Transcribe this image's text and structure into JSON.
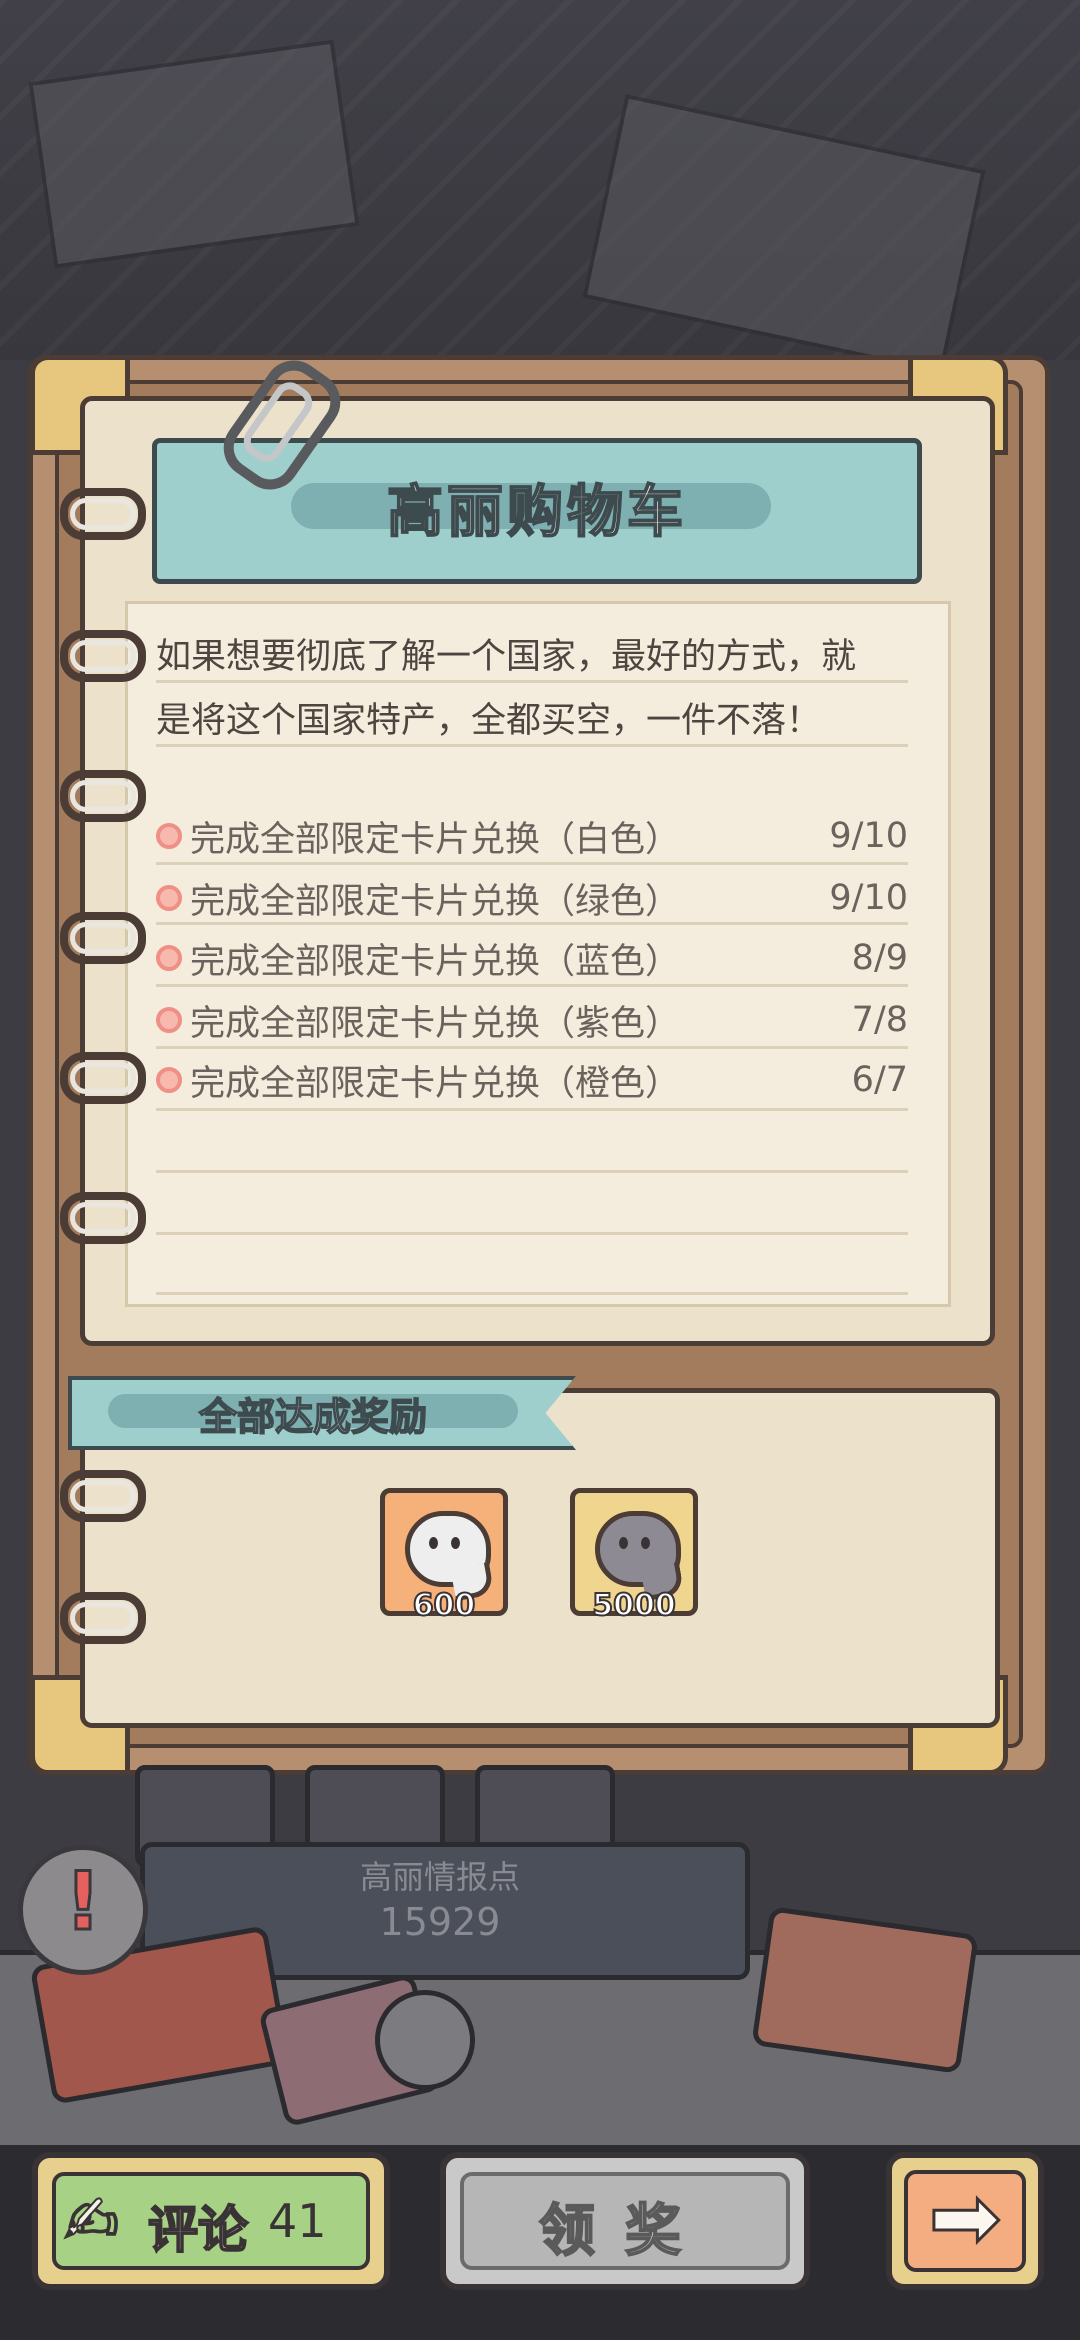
{
  "card": {
    "title": "高丽购物车",
    "description_lines": [
      "如果想要彻底了解一个国家，最好的方式，就",
      "是将这个国家特产，全都买空，一件不落！"
    ],
    "tasks": [
      {
        "label": "完成全部限定卡片兑换（白色）",
        "count": "9/10"
      },
      {
        "label": "完成全部限定卡片兑换（绿色）",
        "count": "9/10"
      },
      {
        "label": "完成全部限定卡片兑换（蓝色）",
        "count": "8/9"
      },
      {
        "label": "完成全部限定卡片兑换（紫色）",
        "count": "7/8"
      },
      {
        "label": "完成全部限定卡片兑换（橙色）",
        "count": "6/7"
      }
    ]
  },
  "rewards": {
    "header": "全部达成奖励",
    "items": [
      {
        "icon": "white-ghost-icon",
        "amount": "600"
      },
      {
        "icon": "gray-ghost-icon",
        "amount": "5000"
      }
    ]
  },
  "scene": {
    "intel_label": "高丽情报点",
    "intel_value": "15929",
    "alert_mark": "!"
  },
  "bottom_bar": {
    "comment_icon": "✍",
    "comment_label": "评论",
    "comment_count": "41",
    "claim_label": "领奖",
    "next_icon": "➡"
  },
  "colors": {
    "background": "#3d3c42",
    "teal_banner": "#9fcfcd",
    "paper": "#f4ecdc",
    "leather": "#b58f6f",
    "task_dot": "#f08f86",
    "reward_orange": "#f6b07a",
    "reward_gold": "#f0d58f",
    "comment_green": "#a7d184",
    "claim_gray": "#b6b6b6",
    "next_orange": "#f3ad80"
  }
}
